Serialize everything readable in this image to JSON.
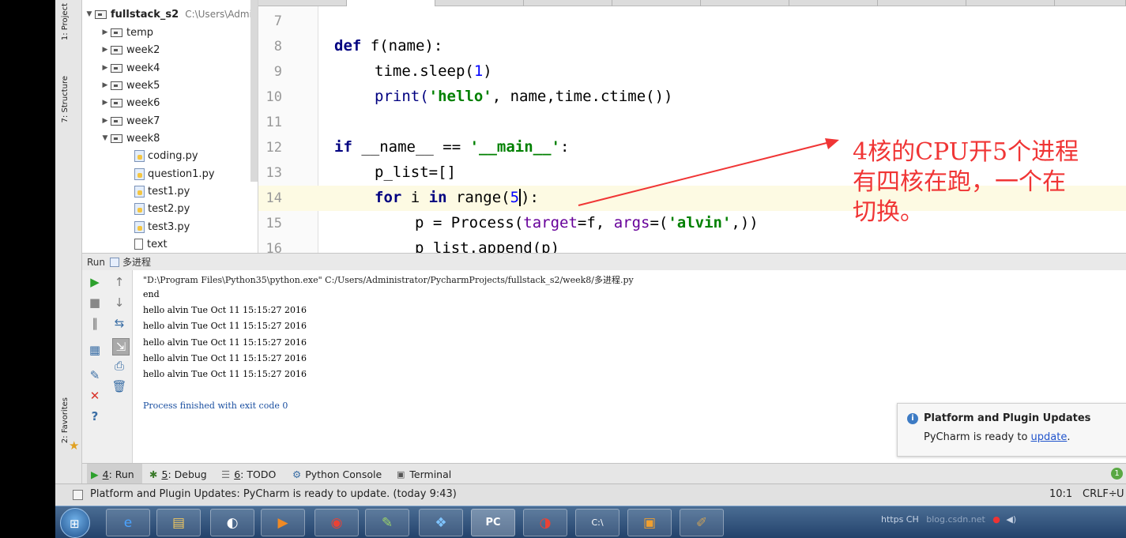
{
  "left_strip": {
    "project_tab": "1: Project",
    "structure_tab": "7: Structure",
    "favorites_tab": "2: Favorites"
  },
  "project_tree": {
    "root_name": "fullstack_s2",
    "root_path": "C:\\Users\\Admin",
    "folders": [
      "temp",
      "week2",
      "week4",
      "week5",
      "week6",
      "week7",
      "week8"
    ],
    "files": [
      "coding.py",
      "question1.py",
      "test1.py",
      "test2.py",
      "test3.py",
      "text"
    ]
  },
  "editor": {
    "line_numbers": [
      "7",
      "8",
      "9",
      "10",
      "11",
      "12",
      "13",
      "14",
      "15",
      "16"
    ],
    "lines": {
      "l8_def": "def",
      "l8_rest": " f(name):",
      "l9_a": "time.sleep(",
      "l9_num": "1",
      "l9_b": ")",
      "l10_a": "print(",
      "l10_str": "'hello'",
      "l10_b": ", name,time.ctime())",
      "l12_if": "if",
      "l12_a": " __name__ == ",
      "l12_str": "'__main__'",
      "l12_b": ":",
      "l13": "p_list=[]",
      "l14_for": "for",
      "l14_a": " i ",
      "l14_in": "in",
      "l14_b": " range(",
      "l14_num": "5",
      "l14_c": "):",
      "l15_a": "p = Process(",
      "l15_kw1": "target",
      "l15_b": "=f, ",
      "l15_kw2": "args",
      "l15_c": "=(",
      "l15_str": "'alvin'",
      "l15_d": ",))",
      "l16": "p_list.append(p)"
    }
  },
  "annotation": {
    "line1": "4核的CPU开5个进程",
    "line2": "有四核在跑，一个在",
    "line3": "切换。",
    "color": "#f03535"
  },
  "run_panel": {
    "header_label": "Run",
    "config_name": "多进程",
    "console_lines": [
      "\"D:\\Program Files\\Python35\\python.exe\" C:/Users/Administrator/PycharmProjects/fullstack_s2/week8/多进程.py",
      "end",
      "hello alvin Tue Oct 11 15:15:27 2016",
      "hello alvin Tue Oct 11 15:15:27 2016",
      "hello alvin Tue Oct 11 15:15:27 2016",
      "hello alvin Tue Oct 11 15:15:27 2016",
      "hello alvin Tue Oct 11 15:15:27 2016"
    ],
    "exit_line": "Process finished with exit code 0"
  },
  "notification": {
    "title": "Platform and Plugin Updates",
    "body_prefix": "PyCharm is ready to ",
    "link": "update",
    "body_suffix": "."
  },
  "bottom_tabs": {
    "run_num": "4",
    "run_label": ": Run",
    "debug_num": "5",
    "debug_label": ": Debug",
    "todo_num": "6",
    "todo_label": ": TODO",
    "console_label": "Python Console",
    "terminal_label": "Terminal",
    "event_count": "1"
  },
  "status_bar": {
    "message": "Platform and Plugin Updates: PyCharm is ready to update. (today 9:43)",
    "position": "10:1",
    "line_sep": "CRLF÷",
    "encoding": "U"
  },
  "taskbar": {
    "tray_text": "https CH",
    "watermark": "blog.csdn.net"
  },
  "colors": {
    "keyword": "#000080",
    "string": "#008000",
    "number": "#0000ff",
    "kwarg": "#660099",
    "annotation": "#f03535",
    "link": "#2255cc"
  }
}
